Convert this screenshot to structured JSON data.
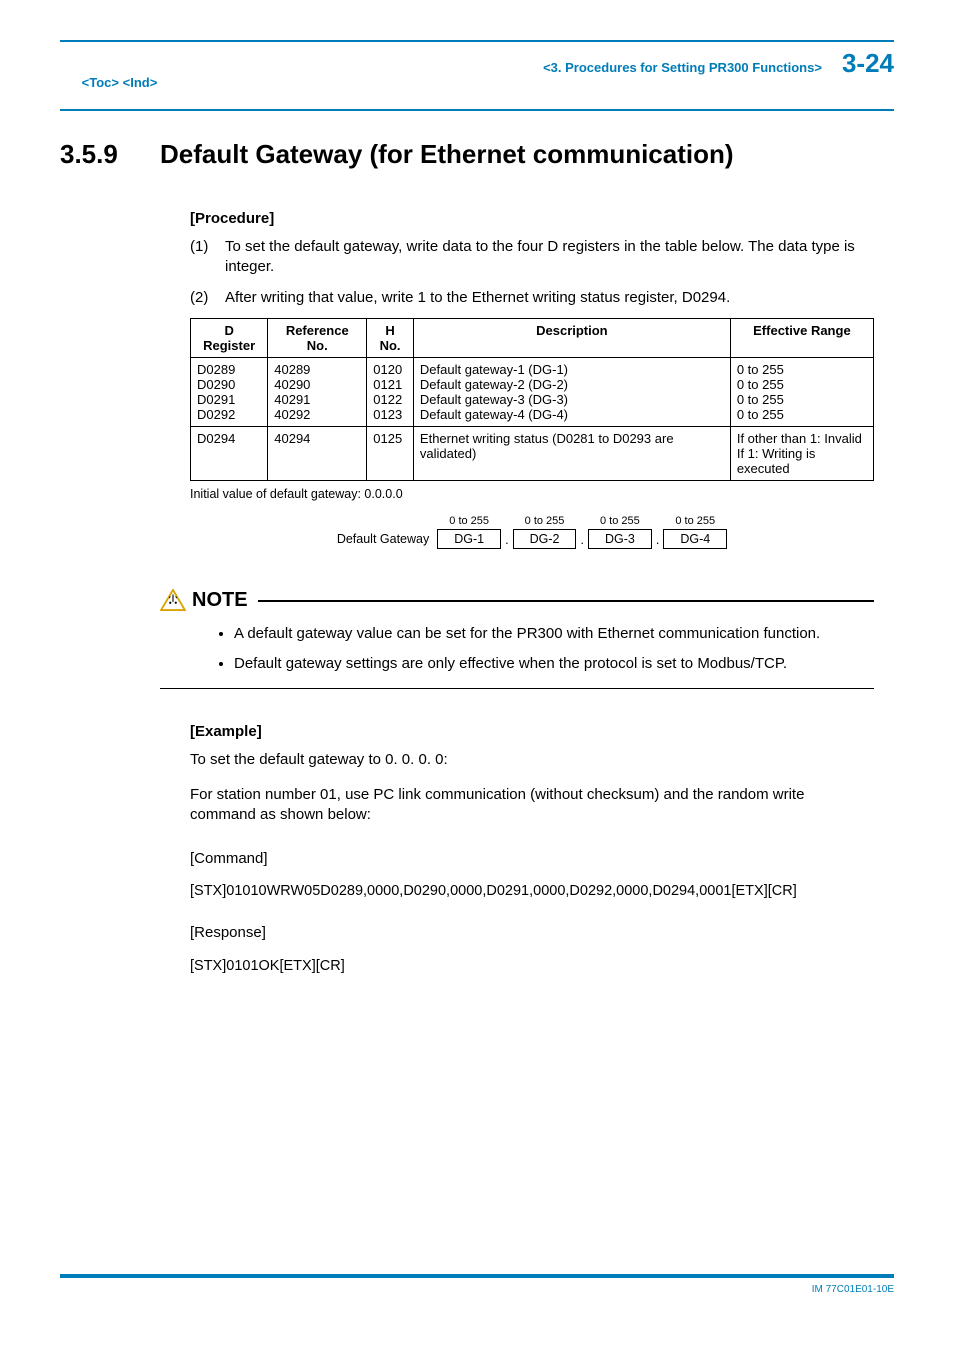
{
  "header": {
    "toc": "<Toc>",
    "ind": "<Ind>",
    "center": "<3.  Procedures for Setting PR300 Functions>",
    "page": "3-24"
  },
  "section": {
    "number": "3.5.9",
    "title": "Default Gateway (for Ethernet communication)"
  },
  "procedure": {
    "heading": "[Procedure]",
    "items": [
      {
        "num": "(1)",
        "text": "To set the default gateway, write data to the four D registers in the table below. The data type is integer."
      },
      {
        "num": "(2)",
        "text": "After writing that value, write 1 to the Ethernet writing status register, D0294."
      }
    ]
  },
  "table": {
    "head": [
      "D Register",
      "Reference No.",
      "H No.",
      "Description",
      "Effective Range"
    ],
    "rows": [
      {
        "dreg": [
          "D0289",
          "D0290",
          "D0291",
          "D0292"
        ],
        "ref": [
          "40289",
          "40290",
          "40291",
          "40292"
        ],
        "hno": [
          "0120",
          "0121",
          "0122",
          "0123"
        ],
        "desc": [
          "Default gateway-1 (DG-1)",
          "Default gateway-2 (DG-2)",
          "Default gateway-3 (DG-3)",
          "Default gateway-4 (DG-4)"
        ],
        "range": [
          "0 to 255",
          "0 to 255",
          "0 to 255",
          "0 to 255"
        ]
      },
      {
        "dreg": [
          "D0294"
        ],
        "ref": [
          "40294"
        ],
        "hno": [
          "0125"
        ],
        "desc": [
          "Ethernet writing status (D0281 to D0293 are validated)"
        ],
        "range": [
          "If other than 1: Invalid",
          "If 1: Writing is executed"
        ]
      }
    ],
    "initial": "Initial value of default gateway: 0.0.0.0"
  },
  "diagram": {
    "label": "Default Gateway",
    "range": "0 to 255",
    "boxes": [
      "DG-1",
      "DG-2",
      "DG-3",
      "DG-4"
    ],
    "sep": "."
  },
  "note": {
    "word": "NOTE",
    "bullets": [
      "A default gateway value can be set for the PR300 with Ethernet communication function.",
      "Default gateway settings are only effective when the protocol is set to Modbus/TCP."
    ]
  },
  "example": {
    "heading": "[Example]",
    "intro1": "To set the default gateway to 0. 0. 0. 0:",
    "intro2": "For station number 01, use PC link communication (without checksum) and the random write command as shown below:",
    "cmd_head": "[Command]",
    "cmd": "[STX]01010WRW05D0289,0000,D0290,0000,D0291,0000,D0292,0000,D0294,0001[ETX][CR]",
    "resp_head": "[Response]",
    "resp": "[STX]0101OK[ETX][CR]"
  },
  "footer": "IM 77C01E01-10E"
}
